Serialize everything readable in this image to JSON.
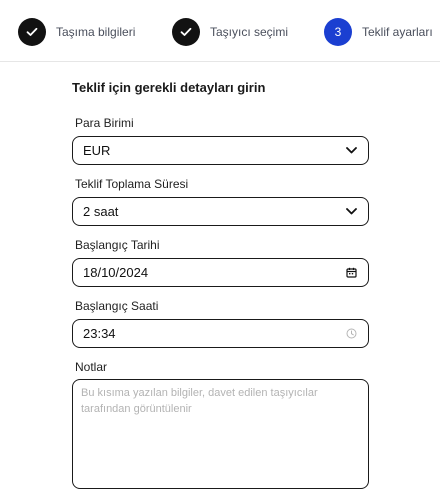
{
  "stepper": {
    "steps": [
      {
        "label": "Taşıma bilgileri",
        "state": "done"
      },
      {
        "label": "Taşıyıcı seçimi",
        "state": "done"
      },
      {
        "label": "Teklif ayarları",
        "state": "active",
        "number": "3"
      }
    ]
  },
  "form": {
    "title": "Teklif için gerekli detayları girin",
    "currency": {
      "label": "Para Birimi",
      "value": "EUR"
    },
    "duration": {
      "label": "Teklif Toplama Süresi",
      "value": "2 saat"
    },
    "start_date": {
      "label": "Başlangıç Tarihi",
      "value": "18/10/2024"
    },
    "start_time": {
      "label": "Başlangıç Saati",
      "value": "23:34"
    },
    "notes": {
      "label": "Notlar",
      "placeholder": "Bu kısıma yazılan bilgiler, davet edilen taşıyıcılar tarafından görüntülenir"
    }
  },
  "icons": {
    "step_done": "check-icon",
    "select": "chevron-down-icon",
    "date": "calendar-icon",
    "time": "clock-icon"
  },
  "colors": {
    "active_step": "#1b3fd1",
    "done_step": "#121212"
  }
}
